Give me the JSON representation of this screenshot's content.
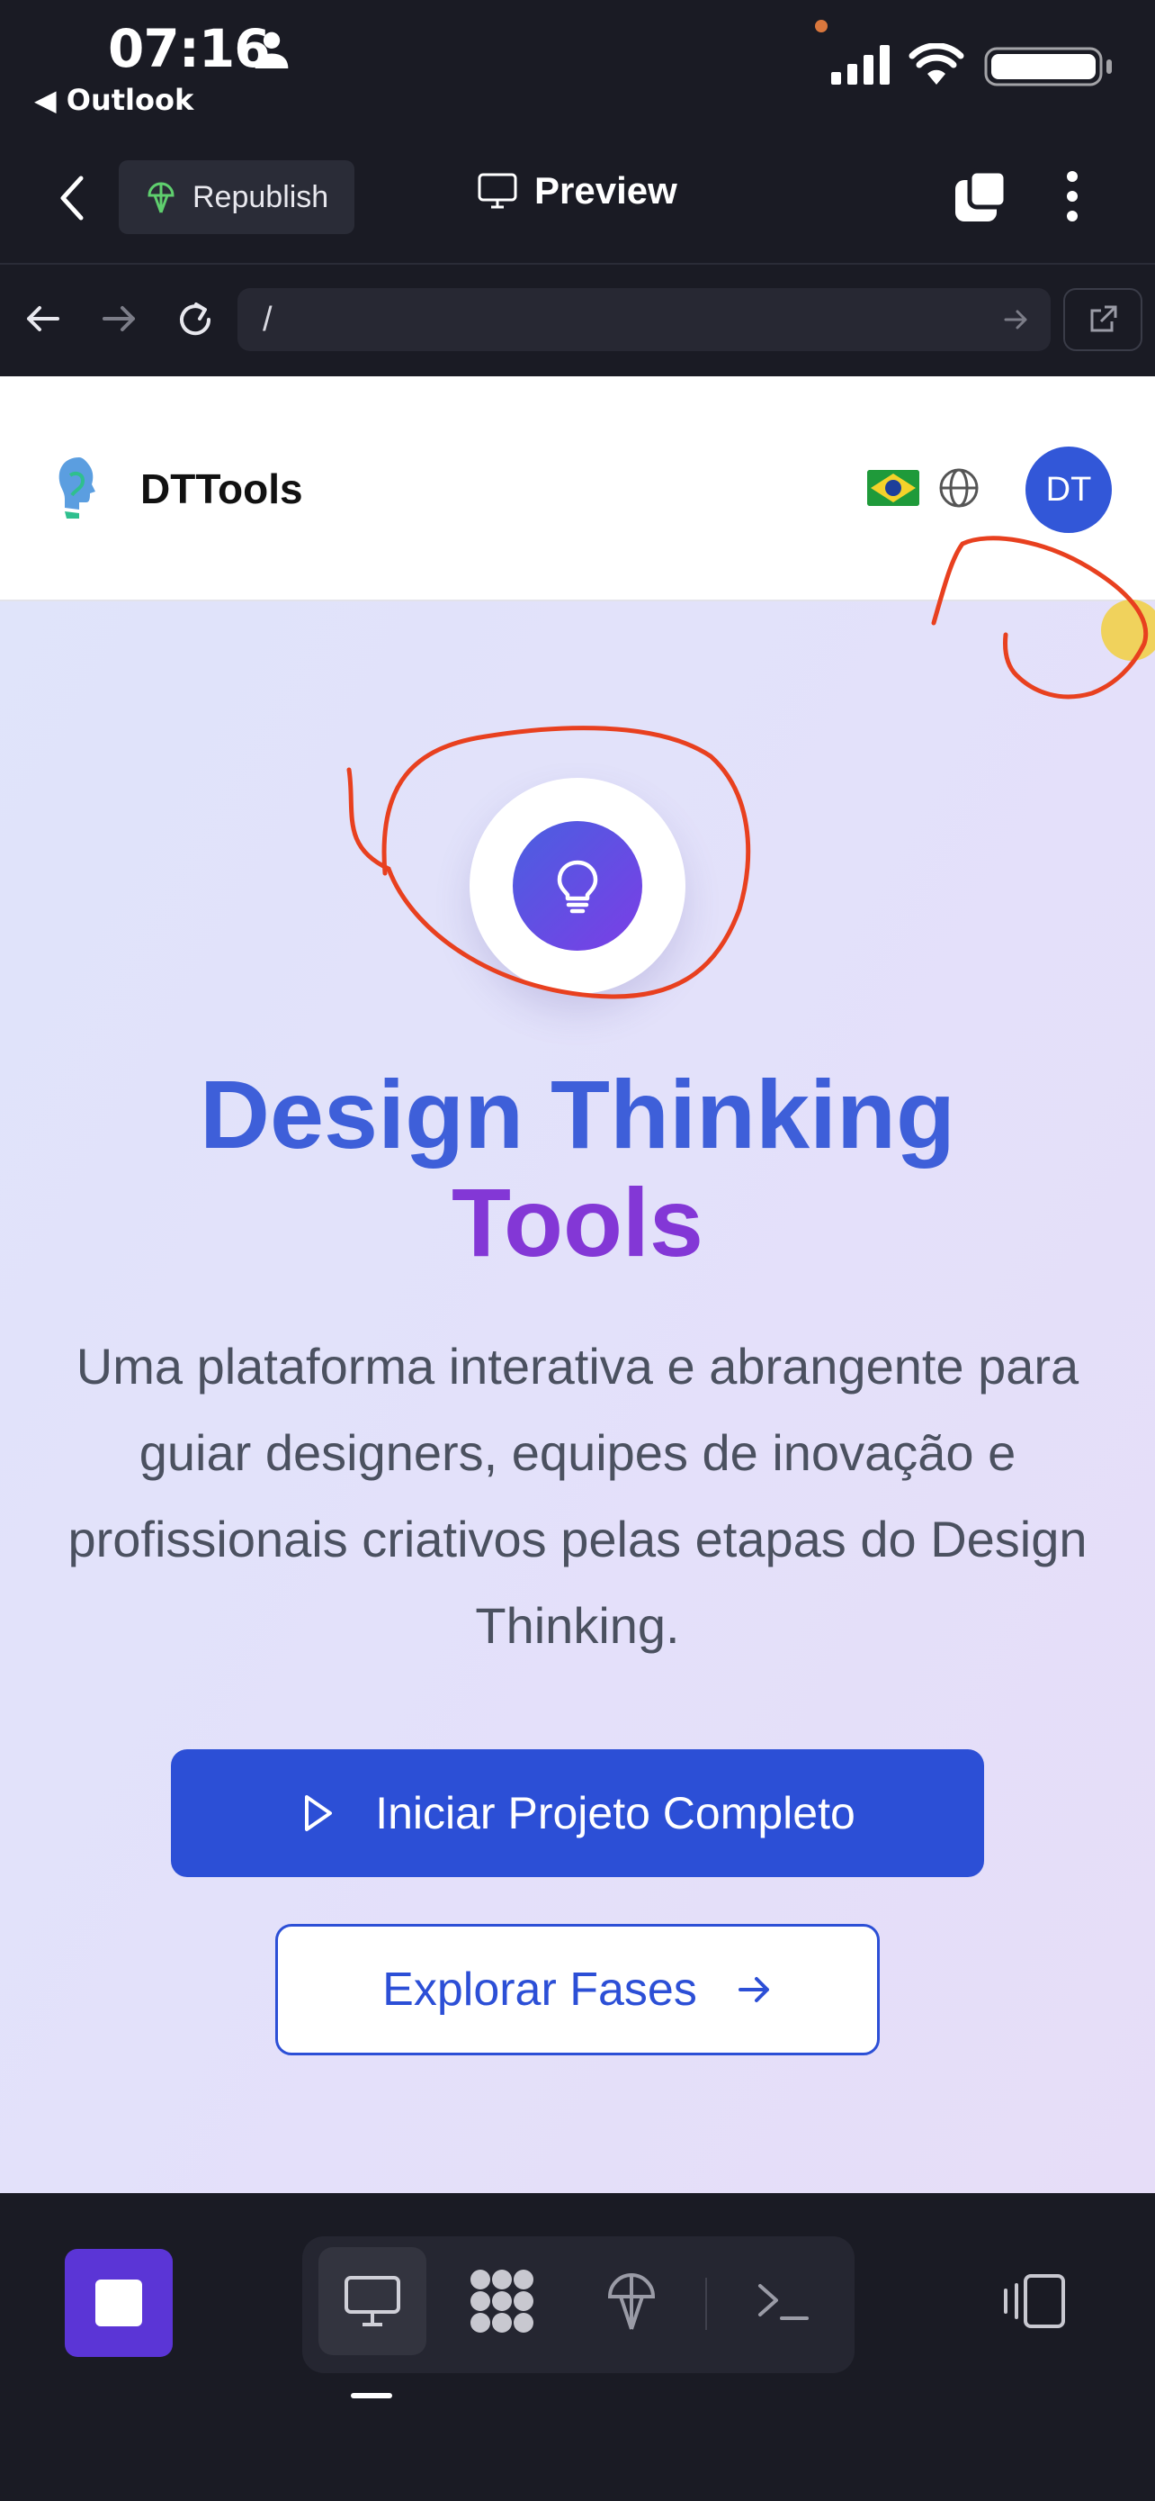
{
  "status_bar": {
    "time": "07:16",
    "back_app": "◀ Outlook"
  },
  "toolbar": {
    "republish_label": "Republish",
    "preview_label": "Preview"
  },
  "address_bar": {
    "url": "/"
  },
  "site": {
    "brand": "DTTools",
    "avatar_initials": "DT",
    "hero_title_line1": "Design Thinking",
    "hero_title_line2": "Tools",
    "hero_description": "Uma plataforma interativa e abrangente para guiar designers, equipes de inovação e profissionais criativos pelas etapas do Design Thinking.",
    "primary_button": "Iniciar Projeto Completo",
    "secondary_button": "Explorar Fases"
  },
  "colors": {
    "accent_blue": "#2c4fd6",
    "title_blue": "#3e5fd9",
    "title_purple": "#8337d6",
    "stop_purple": "#5b35d6",
    "annotation_red": "#e8401f"
  },
  "icons": [
    "person-icon",
    "signal-icon",
    "wifi-icon",
    "battery-icon",
    "chevron-left-icon",
    "republish-icon",
    "monitor-icon",
    "tabs-icon",
    "kebab-icon",
    "arrow-left-icon",
    "arrow-right-icon",
    "reload-icon",
    "external-link-icon",
    "logo-icon",
    "brazil-flag-icon",
    "globe-icon",
    "lightbulb-icon",
    "play-icon",
    "stop-icon",
    "grid-icon",
    "antenna-icon",
    "terminal-icon",
    "devices-icon"
  ]
}
